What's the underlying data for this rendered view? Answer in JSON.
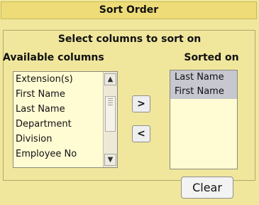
{
  "window": {
    "title": "Sort Order"
  },
  "section": {
    "title": "Select columns to sort on"
  },
  "available": {
    "header": "Available columns",
    "items": [
      "Extension(s)",
      "First Name",
      "Last Name",
      "Department",
      "Division",
      "Employee No"
    ]
  },
  "sorted": {
    "header": "Sorted on",
    "items": [
      "Last Name",
      "First Name"
    ]
  },
  "buttons": {
    "move_right": ">",
    "move_left": "<",
    "clear": "Clear"
  },
  "icons": {
    "scroll_up": "chevron-up-icon",
    "scroll_down": "chevron-down-icon"
  }
}
